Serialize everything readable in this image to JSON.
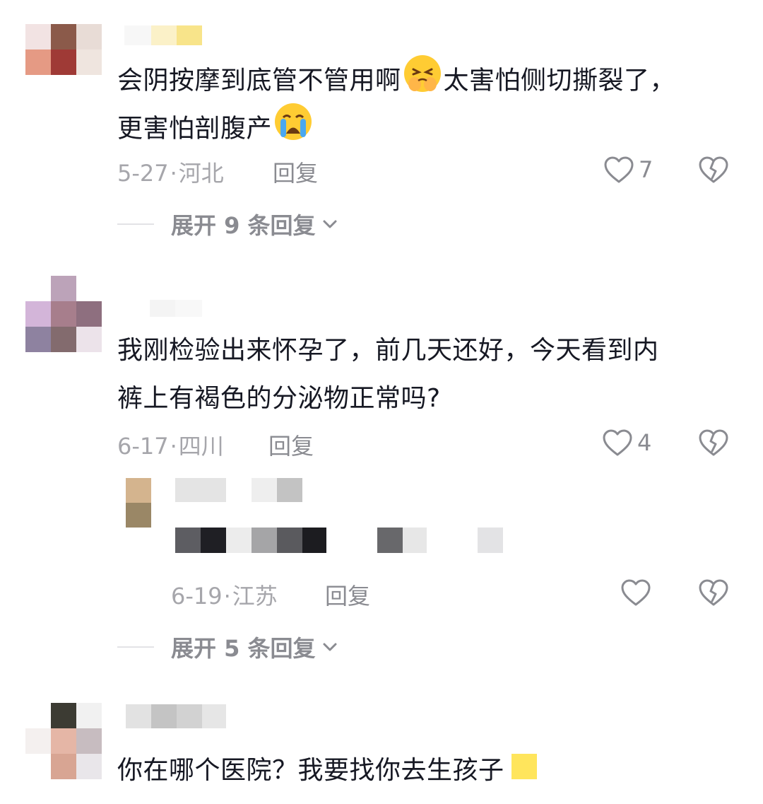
{
  "comments": [
    {
      "text_line1_a": "会阴按摩到底管不管用啊",
      "emoji1": "persevering-face-icon",
      "text_line1_b": "太害怕侧切撕裂了，",
      "text_line2": "更害怕剖腹产",
      "emoji2": "crying-face-icon",
      "date": "5-27",
      "location": "河北",
      "reply_label": "回复",
      "likes": "7",
      "expand_label": "展开 9 条回复"
    },
    {
      "text_line1": "我刚检验出来怀孕了，前几天还好，今天看到内",
      "text_line2": "裤上有褐色的分泌物正常吗?",
      "date": "6-17",
      "location": "四川",
      "reply_label": "回复",
      "likes": "4",
      "sub_reply": {
        "date": "6-19",
        "location": "江苏",
        "reply_label": "回复",
        "likes": ""
      },
      "expand_label": "展开 5 条回复"
    },
    {
      "text_line1": "你在哪个医院？我要找你去生孩子"
    }
  ],
  "separator": "·",
  "colors": {
    "text": "#161823",
    "meta": "#a6a6ab",
    "action": "#8a8b91",
    "emoji_yellow": "#ffcf3f"
  }
}
